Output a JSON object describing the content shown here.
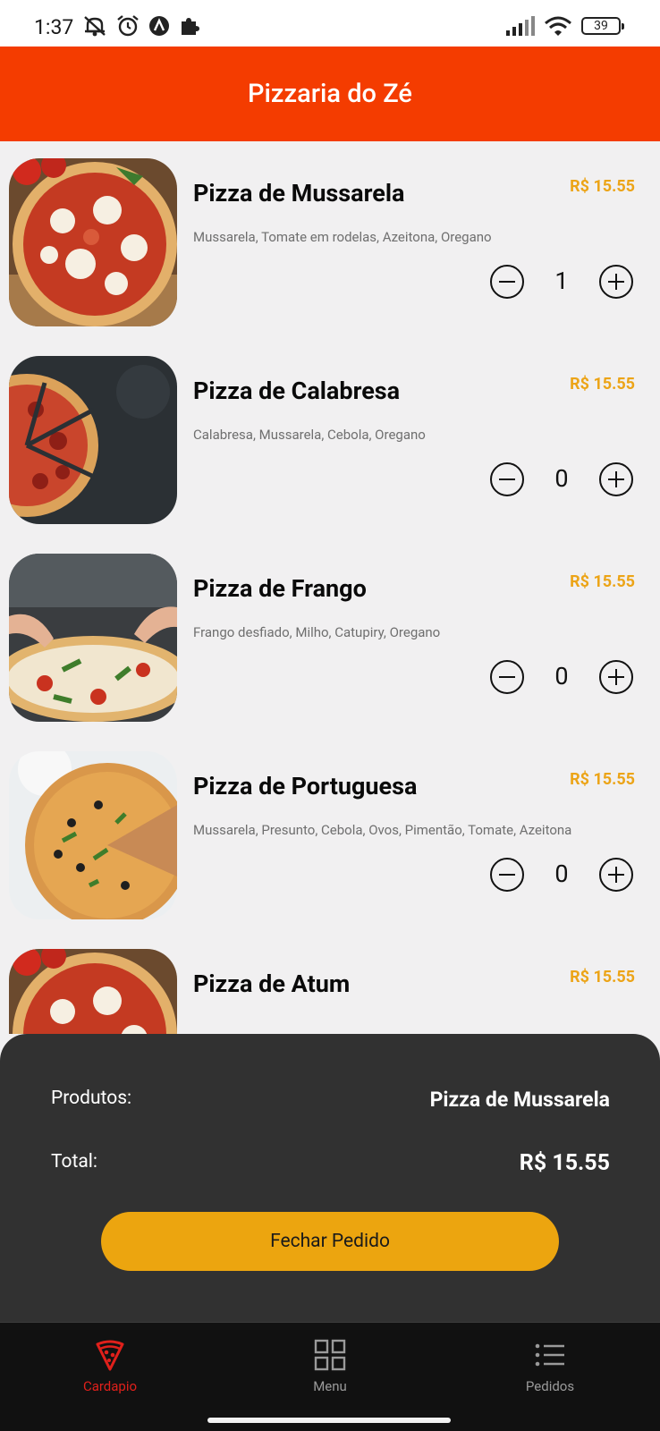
{
  "status_bar": {
    "time": "1:37",
    "battery": "39",
    "icons_left": [
      "muted-bell-icon",
      "alarm-icon",
      "app-a-icon",
      "puzzle-icon"
    ],
    "icons_right": [
      "signal-icon",
      "wifi-icon",
      "battery-icon"
    ]
  },
  "header": {
    "title": "Pizzaria do Zé",
    "background": "#f43c00"
  },
  "products": [
    {
      "name": "Pizza de Mussarela",
      "price": "R$ 15.55",
      "description": "Mussarela, Tomate em rodelas, Azeitona, Oregano",
      "quantity": "1"
    },
    {
      "name": "Pizza de Calabresa",
      "price": "R$ 15.55",
      "description": "Calabresa, Mussarela, Cebola, Oregano",
      "quantity": "0"
    },
    {
      "name": "Pizza de Frango",
      "price": "R$ 15.55",
      "description": "Frango desfiado, Milho, Catupiry, Oregano",
      "quantity": "0"
    },
    {
      "name": "Pizza de Portuguesa",
      "price": "R$ 15.55",
      "description": "Mussarela, Presunto, Cebola, Ovos, Pimentão, Tomate, Azeitona",
      "quantity": "0"
    },
    {
      "name": "Pizza de Atum",
      "price": "R$ 15.55",
      "description": "",
      "quantity": ""
    }
  ],
  "order": {
    "products_label": "Produtos:",
    "products_value": "Pizza de Mussarela",
    "total_label": "Total:",
    "total_value": "R$ 15.55",
    "button_label": "Fechar Pedido",
    "button_color": "#eca50f"
  },
  "nav": [
    {
      "label": "Cardapio",
      "icon": "pizza-slice-icon",
      "active": true
    },
    {
      "label": "Menu",
      "icon": "grid-icon",
      "active": false
    },
    {
      "label": "Pedidos",
      "icon": "list-icon",
      "active": false
    }
  ],
  "colors": {
    "price": "#eca417",
    "nav_active": "#e0201b",
    "nav_inactive": "#9a9a9a"
  }
}
